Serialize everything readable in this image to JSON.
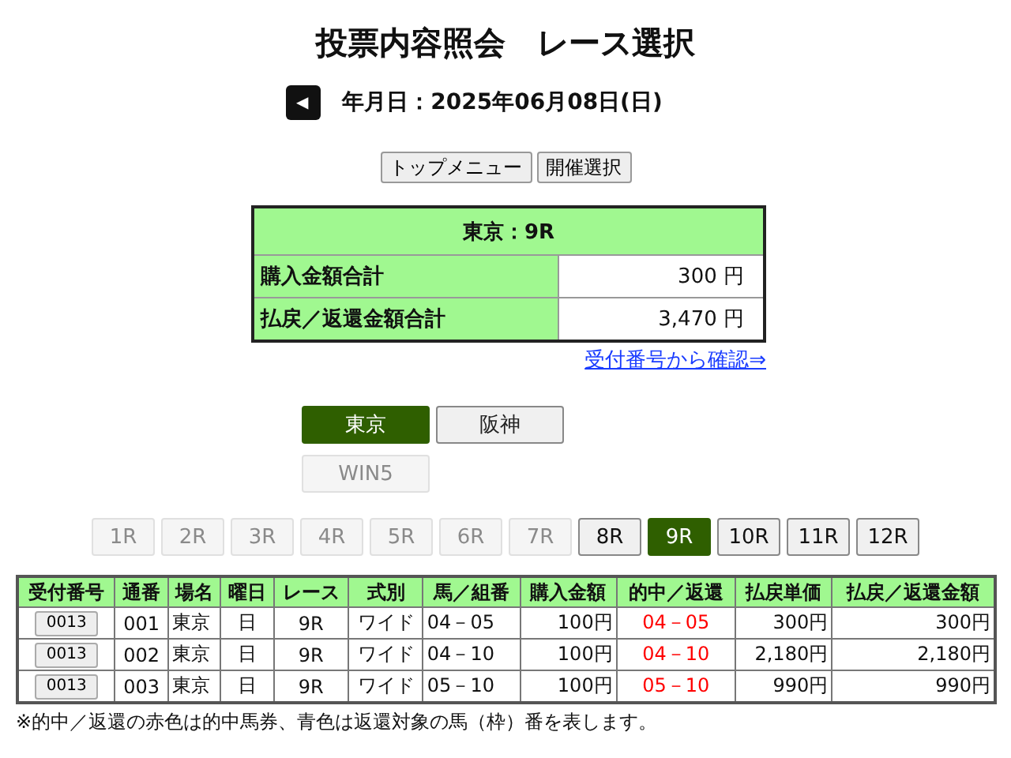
{
  "title": "投票内容照会　レース選択",
  "date": {
    "prev_button": "◀",
    "label": "年月日：2025年06月08日(日)"
  },
  "nav_buttons": [
    "トップメニュー",
    "開催選択"
  ],
  "summary": {
    "heading": "東京：9R",
    "rows": [
      {
        "label": "購入金額合計",
        "value": "300 円"
      },
      {
        "label": "払戻／返還金額合計",
        "value": "3,470 円"
      }
    ]
  },
  "link": "受付番号から確認⇒",
  "venues": [
    {
      "label": "東京",
      "selected": true,
      "disabled": false
    },
    {
      "label": "阪神",
      "selected": false,
      "disabled": false
    },
    {
      "label": "WIN5",
      "selected": false,
      "disabled": true
    }
  ],
  "races": [
    {
      "label": "1R",
      "selected": false,
      "disabled": true
    },
    {
      "label": "2R",
      "selected": false,
      "disabled": true
    },
    {
      "label": "3R",
      "selected": false,
      "disabled": true
    },
    {
      "label": "4R",
      "selected": false,
      "disabled": true
    },
    {
      "label": "5R",
      "selected": false,
      "disabled": true
    },
    {
      "label": "6R",
      "selected": false,
      "disabled": true
    },
    {
      "label": "7R",
      "selected": false,
      "disabled": true
    },
    {
      "label": "8R",
      "selected": false,
      "disabled": false
    },
    {
      "label": "9R",
      "selected": true,
      "disabled": false
    },
    {
      "label": "10R",
      "selected": false,
      "disabled": false
    },
    {
      "label": "11R",
      "selected": false,
      "disabled": false
    },
    {
      "label": "12R",
      "selected": false,
      "disabled": false
    }
  ],
  "table": {
    "columns": [
      "受付番号",
      "通番",
      "場名",
      "曜日",
      "レース",
      "式別",
      "馬／組番",
      "購入金額",
      "的中／返還",
      "払戻単価",
      "払戻／返還金額"
    ],
    "rows": [
      {
        "receipt": "0013",
        "serial": "001",
        "venue": "東京",
        "day": "日",
        "race": "9R",
        "type": "ワイド",
        "combo": "04－05",
        "amount": "100円",
        "result": "04－05",
        "color": "#ff0000",
        "unit": "300円",
        "payout": "300円"
      },
      {
        "receipt": "0013",
        "serial": "002",
        "venue": "東京",
        "day": "日",
        "race": "9R",
        "type": "ワイド",
        "combo": "04－10",
        "amount": "100円",
        "result": "04－10",
        "color": "#ff0000",
        "unit": "2,180円",
        "payout": "2,180円"
      },
      {
        "receipt": "0013",
        "serial": "003",
        "venue": "東京",
        "day": "日",
        "race": "9R",
        "type": "ワイド",
        "combo": "05－10",
        "amount": "100円",
        "result": "05－10",
        "color": "#ff0000",
        "unit": "990円",
        "payout": "990円"
      }
    ]
  },
  "note": "※的中／返還の赤色は的中馬券、青色は返還対象の馬（枠）番を表します。"
}
